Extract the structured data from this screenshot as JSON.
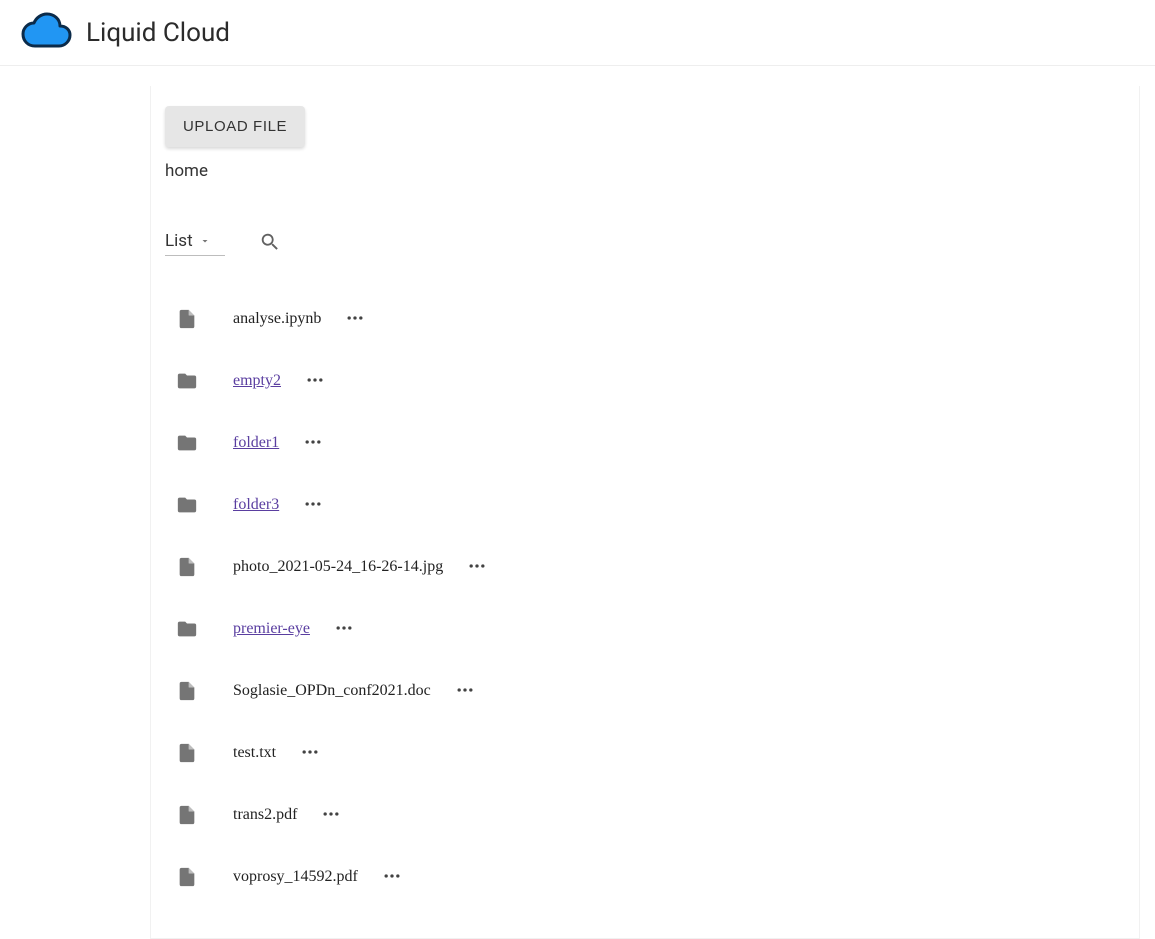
{
  "header": {
    "title": "Liquid Cloud"
  },
  "upload": {
    "label": "UPLOAD FILE"
  },
  "breadcrumb": {
    "path": "home"
  },
  "toolbar": {
    "view_label": "List"
  },
  "items": [
    {
      "type": "file",
      "name": "analyse.ipynb"
    },
    {
      "type": "folder",
      "name": "empty2"
    },
    {
      "type": "folder",
      "name": "folder1"
    },
    {
      "type": "folder",
      "name": "folder3"
    },
    {
      "type": "file",
      "name": "photo_2021-05-24_16-26-14.jpg"
    },
    {
      "type": "folder",
      "name": "premier-eye"
    },
    {
      "type": "file",
      "name": "Soglasie_OPDn_conf2021.doc"
    },
    {
      "type": "file",
      "name": "test.txt"
    },
    {
      "type": "file",
      "name": "trans2.pdf"
    },
    {
      "type": "file",
      "name": "voprosy_14592.pdf"
    }
  ]
}
